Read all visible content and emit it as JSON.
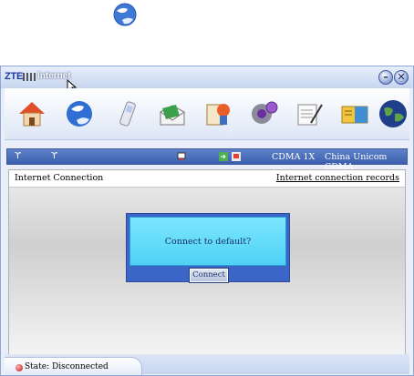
{
  "window": {
    "brand": "ZTE",
    "title": "Internet",
    "minimize_symbol": "–",
    "close_symbol": "✕"
  },
  "desktop": {
    "icon": "internet-globe-icon"
  },
  "toolbar": {
    "items": [
      {
        "icon": "home-icon"
      },
      {
        "icon": "internet-globe-icon"
      },
      {
        "icon": "phone-icon"
      },
      {
        "icon": "sms-envelope-icon"
      },
      {
        "icon": "contacts-icon"
      },
      {
        "icon": "settings-gear-icon"
      },
      {
        "icon": "notepad-icon"
      },
      {
        "icon": "phonebook-icon"
      },
      {
        "icon": "world-globe-icon"
      }
    ]
  },
  "status_strip": {
    "network_mode": "CDMA 1X",
    "operator": "China Unicom CDMA"
  },
  "panel": {
    "title": "Internet Connection",
    "records_link": "Internet connection records"
  },
  "dialog": {
    "message": "Connect to default?",
    "connect_label": "Connect"
  },
  "statusbar": {
    "state": "State: Disconnected"
  },
  "colors": {
    "accent": "#3b66c7",
    "dialog_bg": "#6fe0fb",
    "state_disconnected": "#c01818"
  }
}
